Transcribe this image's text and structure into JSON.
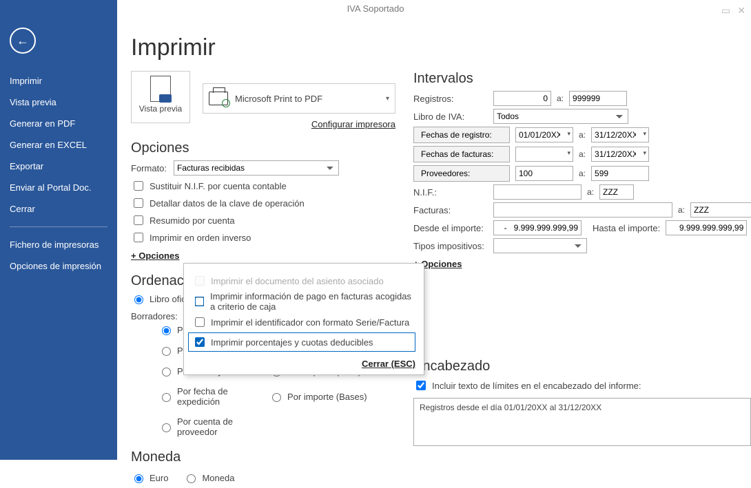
{
  "window": {
    "title": "IVA Soportado"
  },
  "sidebar": {
    "items": [
      "Imprimir",
      "Vista previa",
      "Generar en PDF",
      "Generar en EXCEL",
      "Exportar",
      "Enviar al Portal Doc.",
      "Cerrar"
    ],
    "items2": [
      "Fichero de impresoras",
      "Opciones de impresión"
    ]
  },
  "page": {
    "title": "Imprimir"
  },
  "preview": {
    "label": "Vista previa"
  },
  "printer": {
    "name": "Microsoft Print to PDF"
  },
  "configure_printer": "Configurar impresora",
  "opciones": {
    "title": "Opciones",
    "formato_label": "Formato:",
    "formato_value": "Facturas recibidas",
    "chk1": "Sustituir N.I.F. por cuenta contable",
    "chk2": "Detallar datos de la clave de operación",
    "chk3": "Resumido por cuenta",
    "chk4": "Imprimir en orden inverso",
    "plus": "+ Opciones"
  },
  "ordenacion": {
    "title": "Ordenación",
    "libro": "Libro oficial",
    "borradores": "Borradores:",
    "r1": "Por número de factura",
    "r2": "Por fecha",
    "r3": "Por fecha y nº factura",
    "r4": "Por importe (Total)",
    "r5": "Por fecha de expedición",
    "r6": "Por importe (Bases)",
    "r7": "Por cuenta de proveedor"
  },
  "moneda": {
    "title": "Moneda",
    "r1": "Euro",
    "r2": "Moneda"
  },
  "intervalos": {
    "title": "Intervalos",
    "registros_label": "Registros:",
    "registros_from": "0",
    "registros_to": "999999",
    "libro_label": "Libro de IVA:",
    "libro_value": "Todos",
    "btn_fechas_registro": "Fechas de registro:",
    "btn_fechas_facturas": "Fechas de facturas:",
    "btn_proveedores": "Proveedores:",
    "date_reg_from": "01/01/20XX",
    "date_reg_to": "31/12/20XX",
    "date_fact_from": "",
    "date_fact_to": "31/12/20XX",
    "prov_from": "100",
    "prov_to": "599",
    "nif_label": "N.I.F.:",
    "nif_to": "ZZZ",
    "facturas_label": "Facturas:",
    "facturas_to": "ZZZ",
    "desde_importe_label": "Desde el importe:",
    "desde_importe_value": "-   9.999.999.999,99",
    "hasta_importe_label": "Hasta el importe:",
    "hasta_importe_value": "9.999.999.999,99",
    "tipos_label": "Tipos impositivos:",
    "plus": "+ Opciones",
    "a": "a:"
  },
  "encabezado": {
    "title": "Encabezado",
    "chk": "Incluir texto de límites en el encabezado del informe:",
    "text": "Registros desde el día 01/01/20XX al 31/12/20XX"
  },
  "popup": {
    "chk1": "Imprimir el documento del asiento asociado",
    "chk2": "Imprimir información de pago en facturas acogidas a criterio de caja",
    "chk3": "Imprimir el identificador con formato Serie/Factura",
    "chk4": "Imprimir porcentajes y cuotas deducibles",
    "close": "Cerrar (ESC)"
  }
}
